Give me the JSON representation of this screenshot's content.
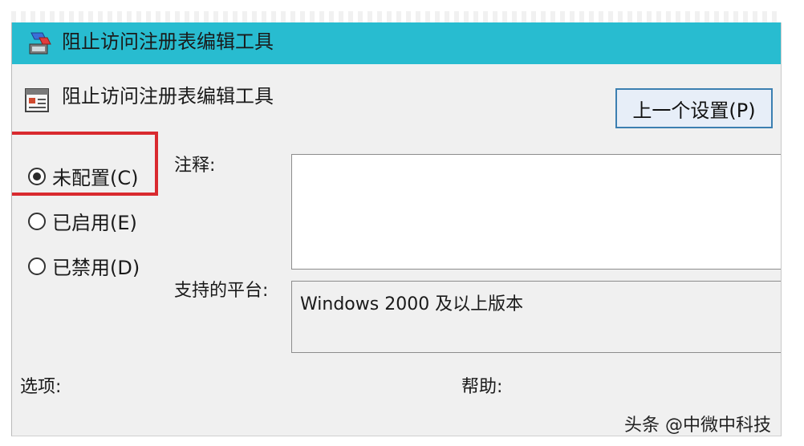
{
  "window": {
    "title": "阻止访问注册表编辑工具",
    "accent_color": "#28bcd0"
  },
  "policy": {
    "name": "阻止访问注册表编辑工具",
    "icon": "policy-setting-icon"
  },
  "buttons": {
    "previous_setting": "上一个设置(P)"
  },
  "options": [
    {
      "label": "未配置(C)",
      "checked": true
    },
    {
      "label": "已启用(E)",
      "checked": false
    },
    {
      "label": "已禁用(D)",
      "checked": false
    }
  ],
  "fields": {
    "comment_label": "注释:",
    "comment_value": "",
    "platform_label": "支持的平台:",
    "platform_value": "Windows 2000 及以上版本",
    "options_label": "选项:",
    "help_label": "帮助:"
  },
  "watermark": "头条 @中微中科技"
}
